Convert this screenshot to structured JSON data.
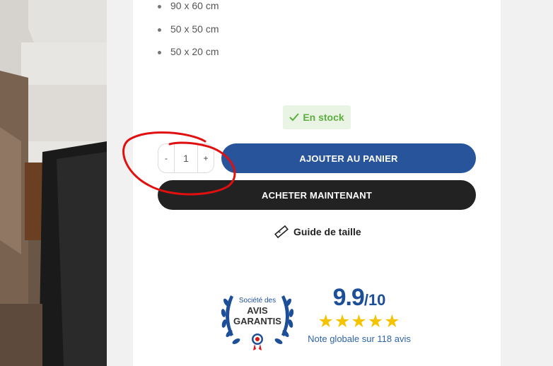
{
  "sizes": [
    "90 x 60 cm",
    "50 x 50 cm",
    "50 x 20 cm"
  ],
  "stock": {
    "label": "En stock",
    "icon": "check-icon",
    "color": "#5cae3f"
  },
  "quantity": {
    "minus": "-",
    "value": "1",
    "plus": "+"
  },
  "buttons": {
    "add_to_cart": "AJOUTER AU PANIER",
    "buy_now": "ACHETER MAINTENANT"
  },
  "colors": {
    "add_to_cart": "#27549b",
    "buy_now": "#222222",
    "annotation": "#e01010",
    "rating": "#1d4f98",
    "stars": "#f5c400"
  },
  "size_guide": {
    "label": "Guide de taille",
    "icon": "ruler-icon"
  },
  "reviews": {
    "badge_line1": "Société des",
    "badge_line2": "AVIS",
    "badge_line3": "GARANTIS",
    "score": "9.9",
    "scale": "/10",
    "rating_stars": 5,
    "stars_text": "★★★★★",
    "note": "Note globale sur 118 avis"
  }
}
